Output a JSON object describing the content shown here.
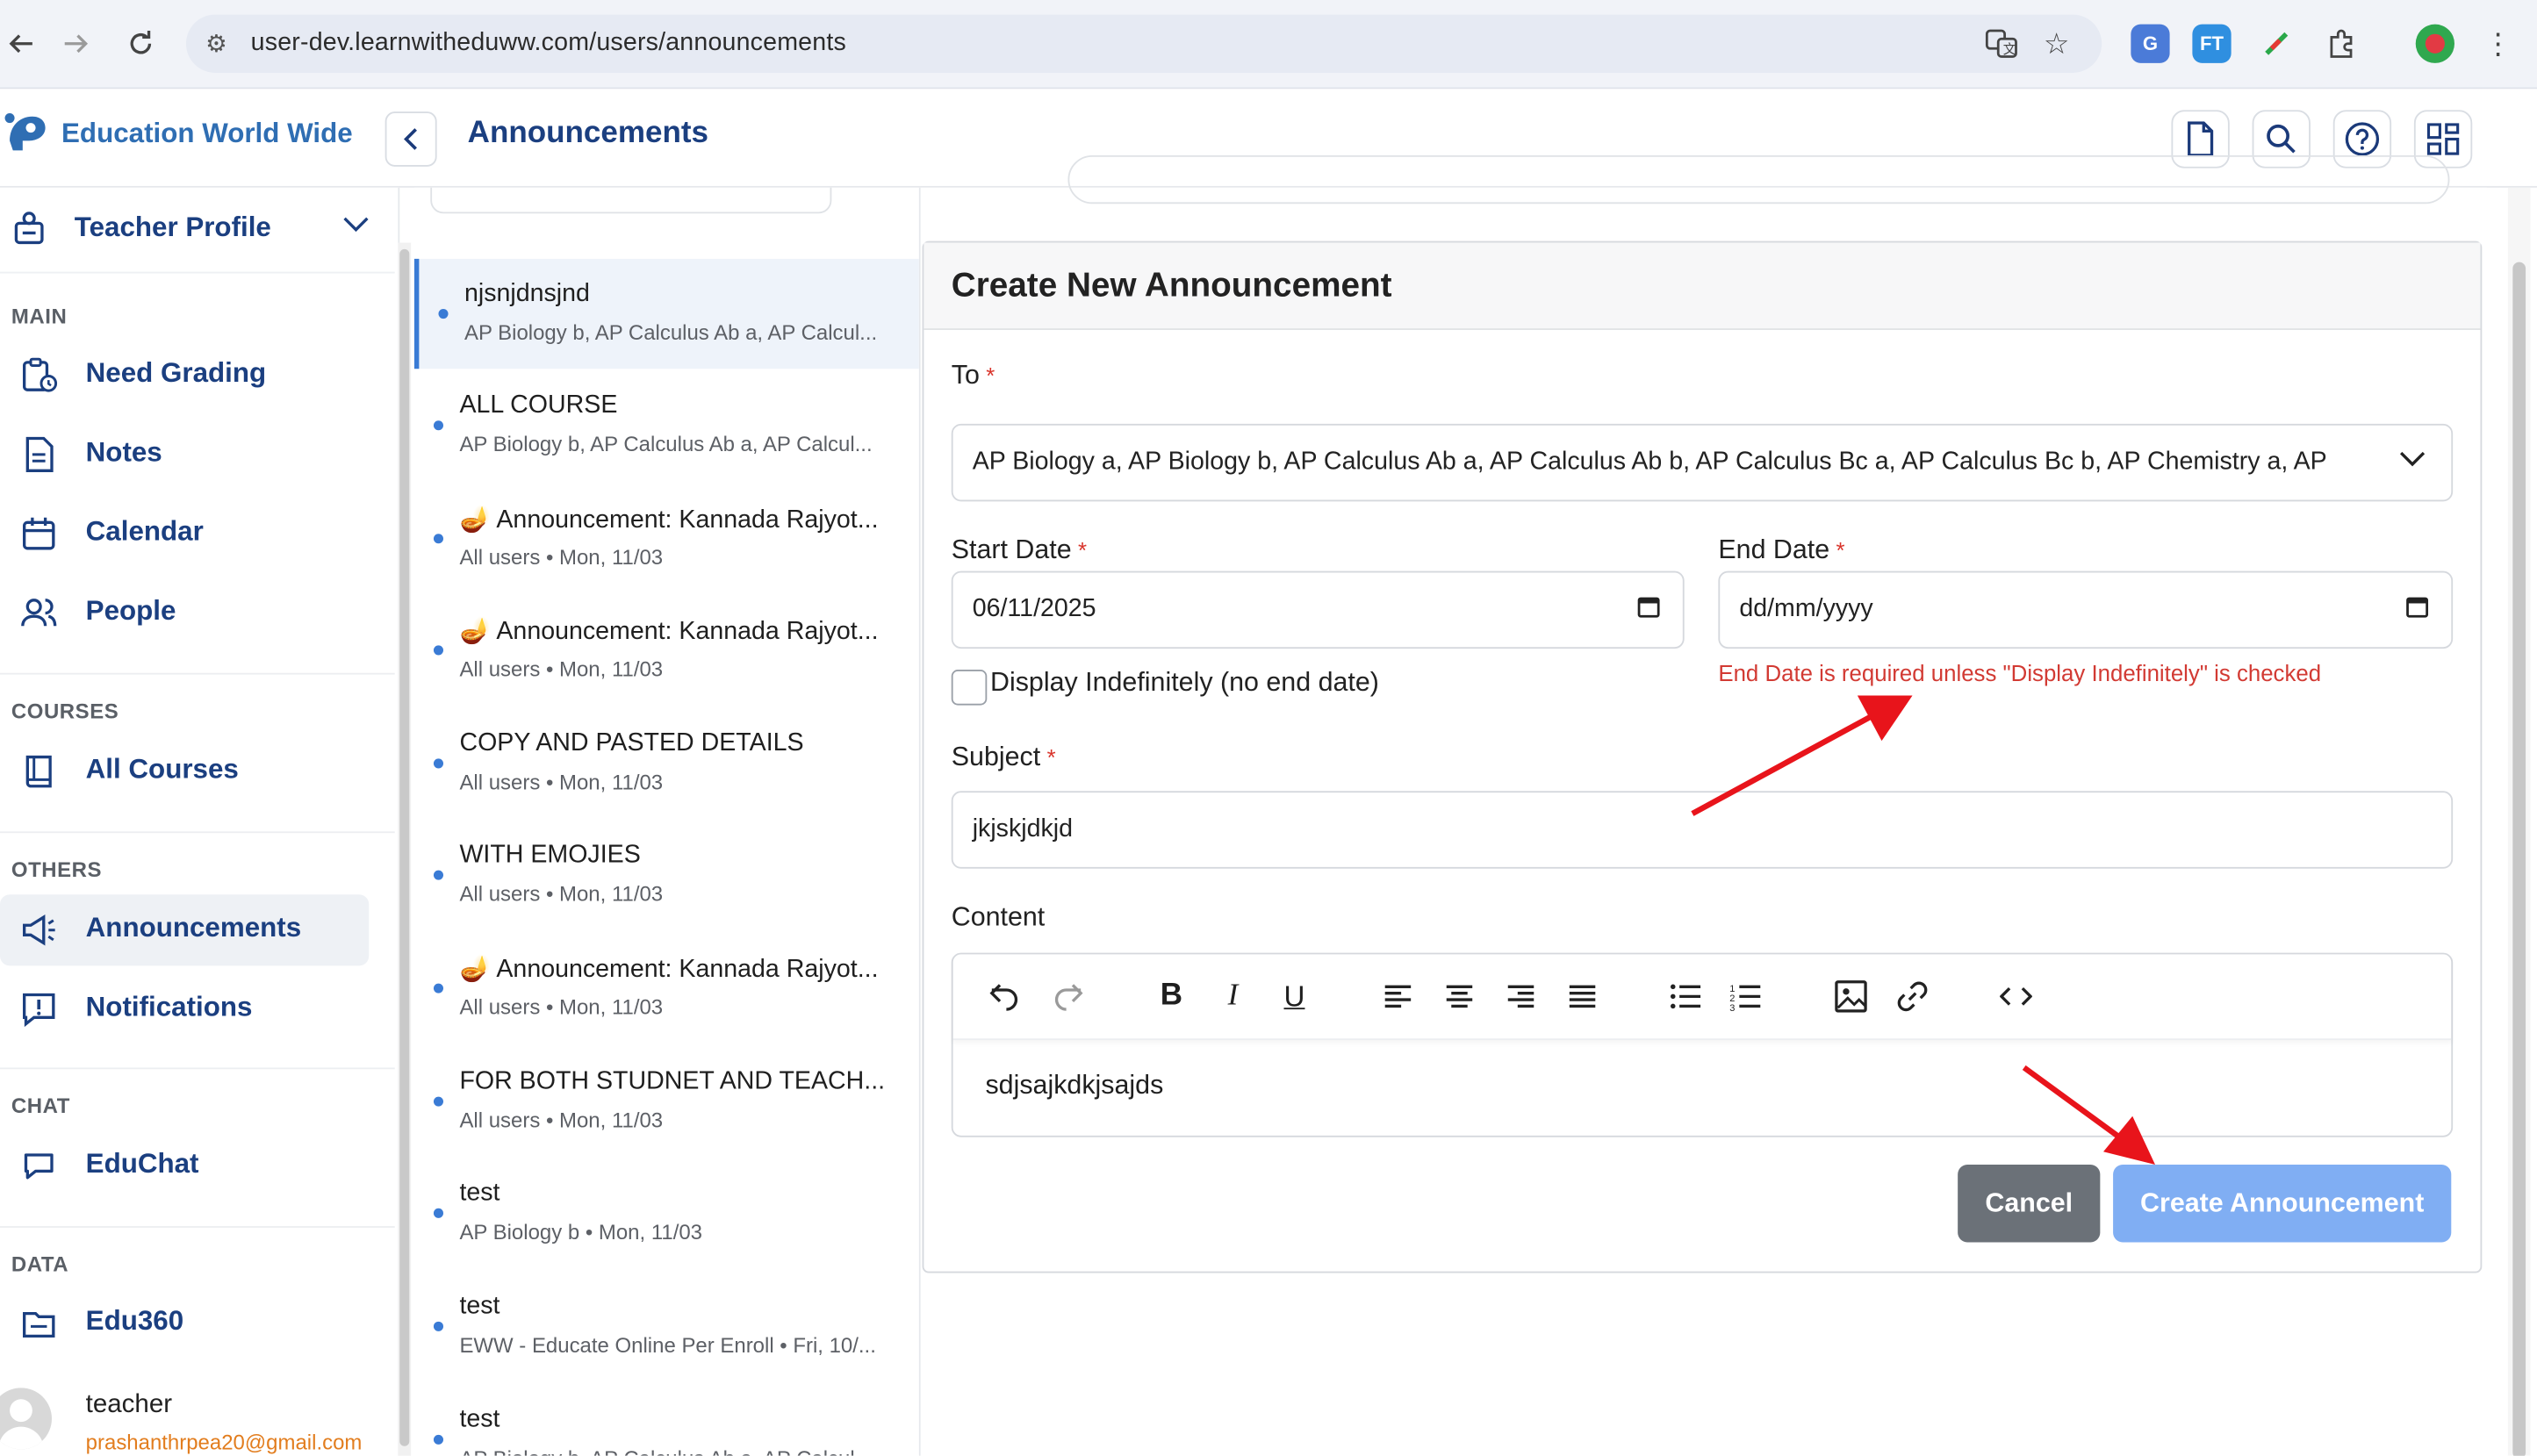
{
  "browser": {
    "url": "user-dev.learnwitheduww.com/users/announcements"
  },
  "app": {
    "brand": "Education World Wide",
    "page_title": "Announcements"
  },
  "sidebar": {
    "profile_label": "Teacher Profile",
    "sections": {
      "main": "MAIN",
      "courses": "COURSES",
      "others": "OTHERS",
      "chat": "CHAT",
      "data": "DATA"
    },
    "items": {
      "need_grading": "Need Grading",
      "notes": "Notes",
      "calendar": "Calendar",
      "people": "People",
      "all_courses": "All Courses",
      "announcements": "Announcements",
      "notifications": "Notifications",
      "educhat": "EduChat",
      "edu360": "Edu360"
    },
    "user": {
      "name": "teacher",
      "email": "prashanthrpea20@gmail.com"
    }
  },
  "list": [
    {
      "title": "njsnjdnsjnd",
      "sub": "AP Biology b, AP Calculus Ab a, AP Calcul..."
    },
    {
      "title": "ALL COURSE",
      "sub": "AP Biology b, AP Calculus Ab a, AP Calcul..."
    },
    {
      "title": "🪔 Announcement: Kannada Rajyot...",
      "sub": "All users • Mon, 11/03"
    },
    {
      "title": "🪔 Announcement: Kannada Rajyot...",
      "sub": "All users • Mon, 11/03"
    },
    {
      "title": "COPY AND PASTED DETAILS",
      "sub": "All users • Mon, 11/03"
    },
    {
      "title": "WITH EMOJIES",
      "sub": "All users • Mon, 11/03"
    },
    {
      "title": "🪔 Announcement: Kannada Rajyot...",
      "sub": "All users • Mon, 11/03"
    },
    {
      "title": "FOR BOTH STUDNET AND TEACH...",
      "sub": "All users • Mon, 11/03"
    },
    {
      "title": "test",
      "sub": "AP Biology b • Mon, 11/03"
    },
    {
      "title": "test",
      "sub": "EWW - Educate Online Per Enroll • Fri, 10/..."
    },
    {
      "title": "test",
      "sub": "AP Biology b, AP Calculus Ab a, AP Calcul..."
    }
  ],
  "form": {
    "title": "Create New Announcement",
    "to_label": "To",
    "to_value": "AP Biology a, AP Biology b, AP Calculus Ab a, AP Calculus Ab b, AP Calculus Bc a, AP Calculus Bc b, AP Chemistry a, AP",
    "start_label": "Start Date",
    "start_value": "06/11/2025",
    "end_label": "End Date",
    "end_placeholder": "dd/mm/yyyy",
    "end_error": "End Date is required unless \"Display Indefinitely\" is checked",
    "indef_label": "Display Indefinitely (no end date)",
    "subject_label": "Subject",
    "subject_value": "jkjskjdkjd",
    "content_label": "Content",
    "content_value": "sdjsajkdkjsajds",
    "required_mark": "*",
    "cancel": "Cancel",
    "create": "Create Announcement"
  },
  "colors": {
    "primary": "#1b3f80",
    "accent": "#3a7bd5",
    "error": "#d23a33",
    "create_button": "#80aef3",
    "cancel_button": "#6b7178",
    "annotation_arrow": "#e8141b"
  },
  "icons": [
    "back-icon",
    "forward-icon",
    "reload-icon",
    "site-settings-icon",
    "translate-icon",
    "bookmark-star-icon",
    "extension-icon",
    "profile-icon",
    "more-icon",
    "document-icon",
    "search-icon",
    "help-icon",
    "grid-icon",
    "chevron-left-icon",
    "chevron-down-icon",
    "calendar-icon",
    "undo-icon",
    "redo-icon",
    "bold-icon",
    "italic-icon",
    "underline-icon",
    "align-left-icon",
    "align-center-icon",
    "align-right-icon",
    "align-justify-icon",
    "bullet-list-icon",
    "numbered-list-icon",
    "image-icon",
    "link-icon",
    "code-icon"
  ]
}
